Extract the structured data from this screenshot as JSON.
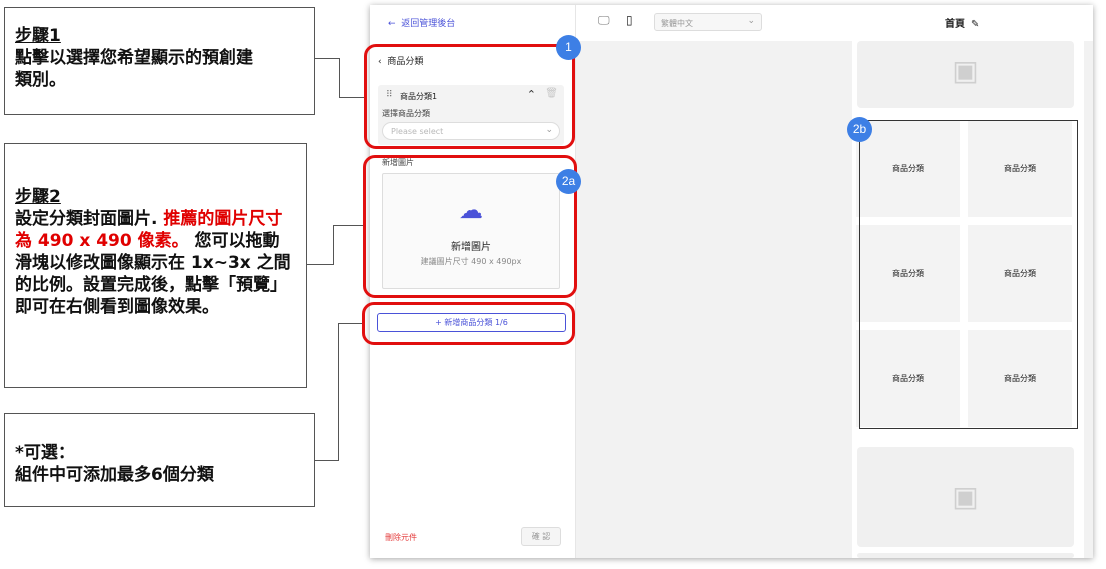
{
  "notes": {
    "step1": {
      "title": "步驟1",
      "lines": [
        "點擊以選擇您希望顯示的預創建",
        "類別。"
      ]
    },
    "step2": {
      "title": "步驟2",
      "lines_before": "設定分類封面圖片.",
      "highlight": "推薦的圖片尺寸為 490 x 490 像素。",
      "lines_after": "您可以拖動滑塊以修改圖像顯示在 1x~3x 之間的比例。設置完成後，點擊「預覽」即可在右側看到圖像效果。"
    },
    "optional": {
      "title": "*可選：",
      "text": "組件中可添加最多6個分類"
    }
  },
  "sidebar": {
    "back_label": "返回管理後台",
    "section_title": "商品分類",
    "item": {
      "name": "商品分類1",
      "select_label": "選擇商品分類",
      "select_placeholder": "Please select"
    },
    "image_label": "新增圖片",
    "upload": {
      "title": "新增圖片",
      "hint": "建議圖片尺寸 490 x 490px"
    },
    "add_button": "+ 新增商品分類 1/6",
    "delete_label": "刪除元件",
    "confirm_label": "確 認"
  },
  "canvas": {
    "language": "繁體中文",
    "page_name": "首頁",
    "grid_cells": [
      "商品分類",
      "商品分類",
      "商品分類",
      "商品分類",
      "商品分類",
      "商品分類"
    ]
  },
  "badges": [
    "1",
    "2a",
    "2b"
  ],
  "colors": {
    "accent": "#4a52d8",
    "highlight": "#e10f0f",
    "badge": "#3d7fe5",
    "danger": "#e43b3b"
  }
}
